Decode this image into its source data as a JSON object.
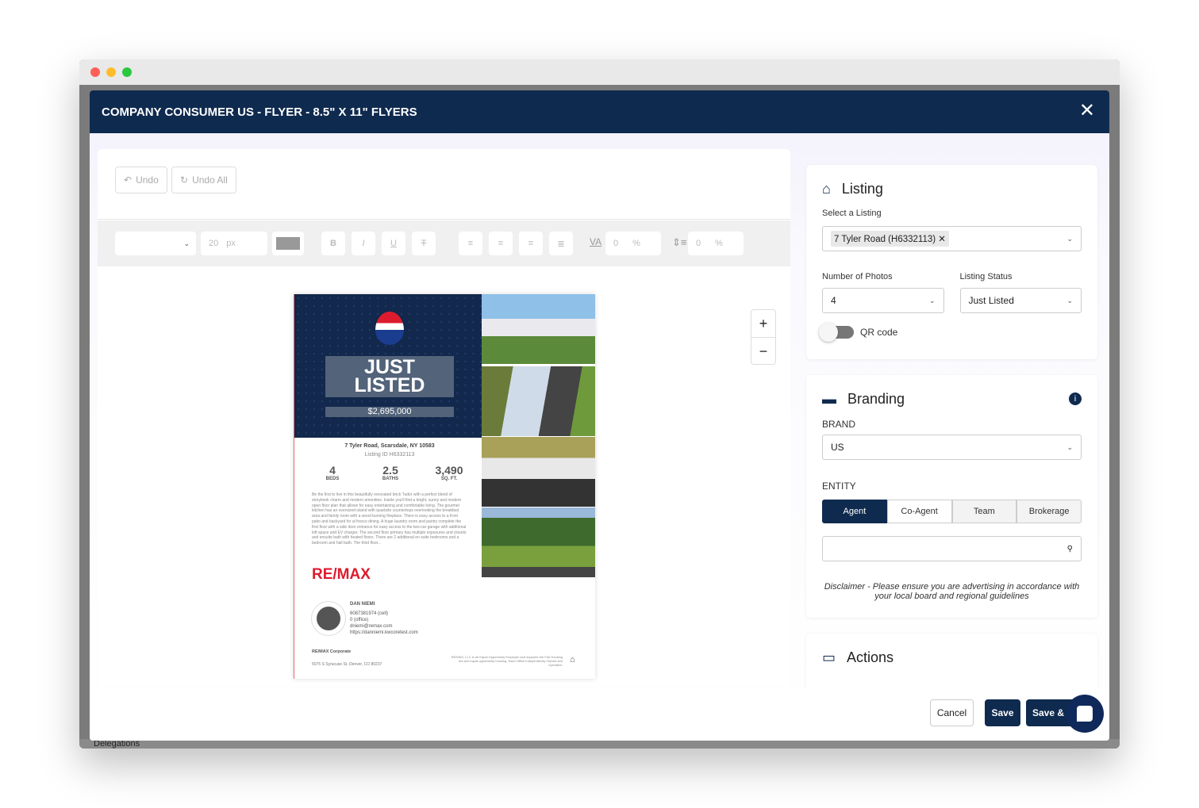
{
  "modal": {
    "title": "COMPANY CONSUMER US - FLYER - 8.5\" X 11\" FLYERS"
  },
  "editor": {
    "undo": "Undo",
    "undo_all": "Undo All",
    "font_size": "20",
    "font_unit": "px",
    "letter_spacing": "0",
    "line_height": "0",
    "percent": "%",
    "bold": "B",
    "italic": "I",
    "underline": "U",
    "strike": "T"
  },
  "flyer": {
    "headline1": "JUST",
    "headline2": "LISTED",
    "price": "$2,695,000",
    "address": "7 Tyler Road, Scarsdale, NY 10583",
    "listing_id": "Listing ID H6332113",
    "beds": "4",
    "beds_label": "BEDS",
    "baths": "2.5",
    "baths_label": "BATHS",
    "sqft": "3,490",
    "sqft_label": "SQ. FT.",
    "description": "Be the first to live in this beautifully renovated brick Tudor with a perfect blend of storybook charm and modern amenities. Inside you'll find a bright, sunny and modern open floor plan that allows for easy entertaining and comfortable living. The gourmet kitchen has an oversized island with quartzite countertops overlooking the breakfast area and family room with a wood burning fireplace. There is easy access to a front patio and backyard for al fresco dining. A huge laundry room and pantry complete the first floor with a side door entrance for easy access to the two-car garage with additional loft space and EV charger. The second floor primary has multiple exposures and closets and ensuite bath with heated floors. There are 2 additional en suite bedrooms and a bedroom and hall bath. The third floor...",
    "brand_logo": "RE/MAX",
    "agent_name": "DAN NIEMI",
    "agent_cell": "6087381974 (cell)",
    "agent_office": "0 (office)",
    "agent_email": "dniemi@remax.com",
    "agent_web": "https://danniemi.kwcoretest.com",
    "company": "RE/MAX Corporate",
    "company_address": "5075 S Syracuse St, Denver, CO 80237",
    "legal": "RE/MAX, LLC is an Equal Opportunity Employer and supports the Fair Housing Act and equal opportunity housing. Each Office Independently Owned and Operated."
  },
  "listing": {
    "title": "Listing",
    "select_label": "Select a Listing",
    "selected": "7 Tyler Road (H6332113)",
    "photos_label": "Number of Photos",
    "photos_value": "4",
    "status_label": "Listing Status",
    "status_value": "Just Listed",
    "qr_label": "QR code",
    "qr_enabled": false
  },
  "branding": {
    "title": "Branding",
    "brand_label": "BRAND",
    "brand_value": "US",
    "entity_label": "ENTITY",
    "entities": [
      "Agent",
      "Co-Agent",
      "Team",
      "Brokerage"
    ],
    "selected_entity": "Agent",
    "search_placeholder": "",
    "disclaimer": "Disclaimer - Please ensure you are advertising in accordance with your local board and regional guidelines"
  },
  "actions": {
    "title": "Actions"
  },
  "footer": {
    "cancel": "Cancel",
    "save": "Save",
    "save_and": "Save & C"
  },
  "background": {
    "delegations": "Delegations"
  },
  "colors": {
    "navy": "#0f2a4f",
    "remax_red": "#dc1c2e",
    "remax_blue": "#1a3d8f"
  }
}
